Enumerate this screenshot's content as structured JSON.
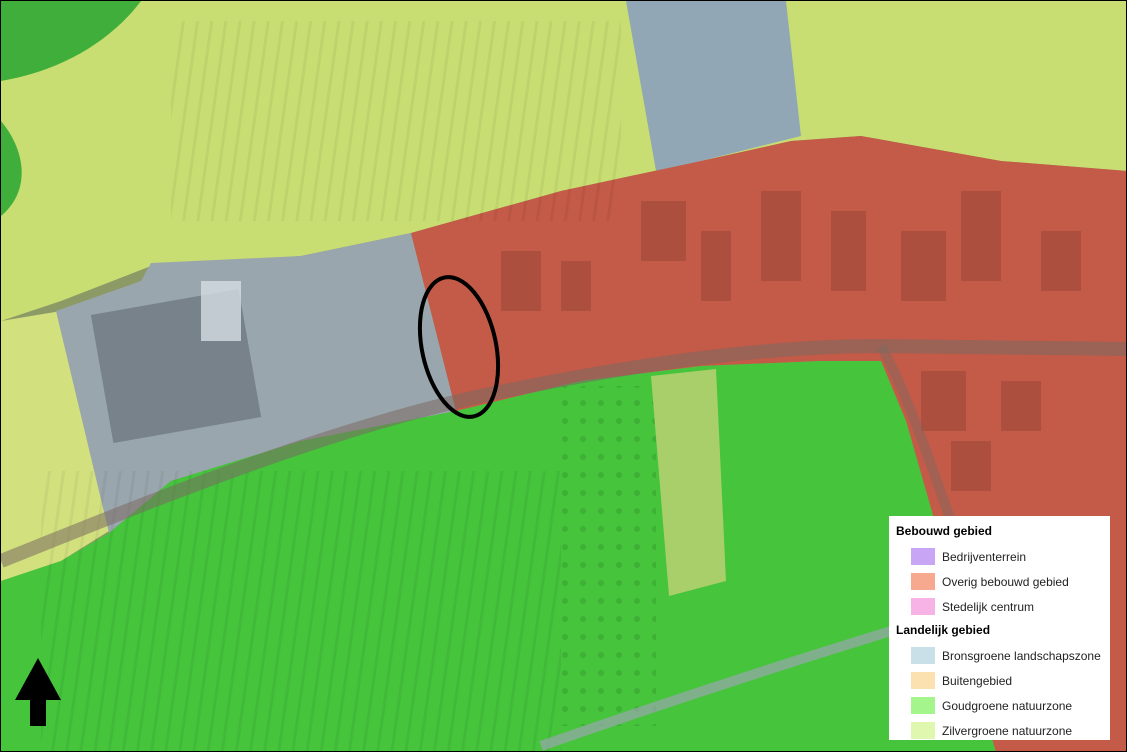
{
  "legend": {
    "groups": [
      {
        "title": "Bebouwd gebied",
        "items": [
          {
            "label": "Bedrijventerrein",
            "color": "#c8a6f5"
          },
          {
            "label": "Overig bebouwd gebied",
            "color": "#f7a98f"
          },
          {
            "label": "Stedelijk centrum",
            "color": "#f7b3e6"
          }
        ]
      },
      {
        "title": "Landelijk gebied",
        "items": [
          {
            "label": "Bronsgroene landschapszone",
            "color": "#c9e0e8"
          },
          {
            "label": "Buitengebied",
            "color": "#fbe0b0"
          },
          {
            "label": "Goudgroene natuurzone",
            "color": "#a3f58c"
          },
          {
            "label": "Zilvergroene natuurzone",
            "color": "#e0f7b0"
          }
        ]
      }
    ]
  },
  "zones": {
    "zilvergroen": "#cfe07a",
    "goudgroen": "#3fcf3a",
    "bronsgroen": "#8fa8b8",
    "bebouwd": "#c4584a",
    "highlight_outline": "#000000"
  },
  "north_arrow": "north-arrow-icon"
}
